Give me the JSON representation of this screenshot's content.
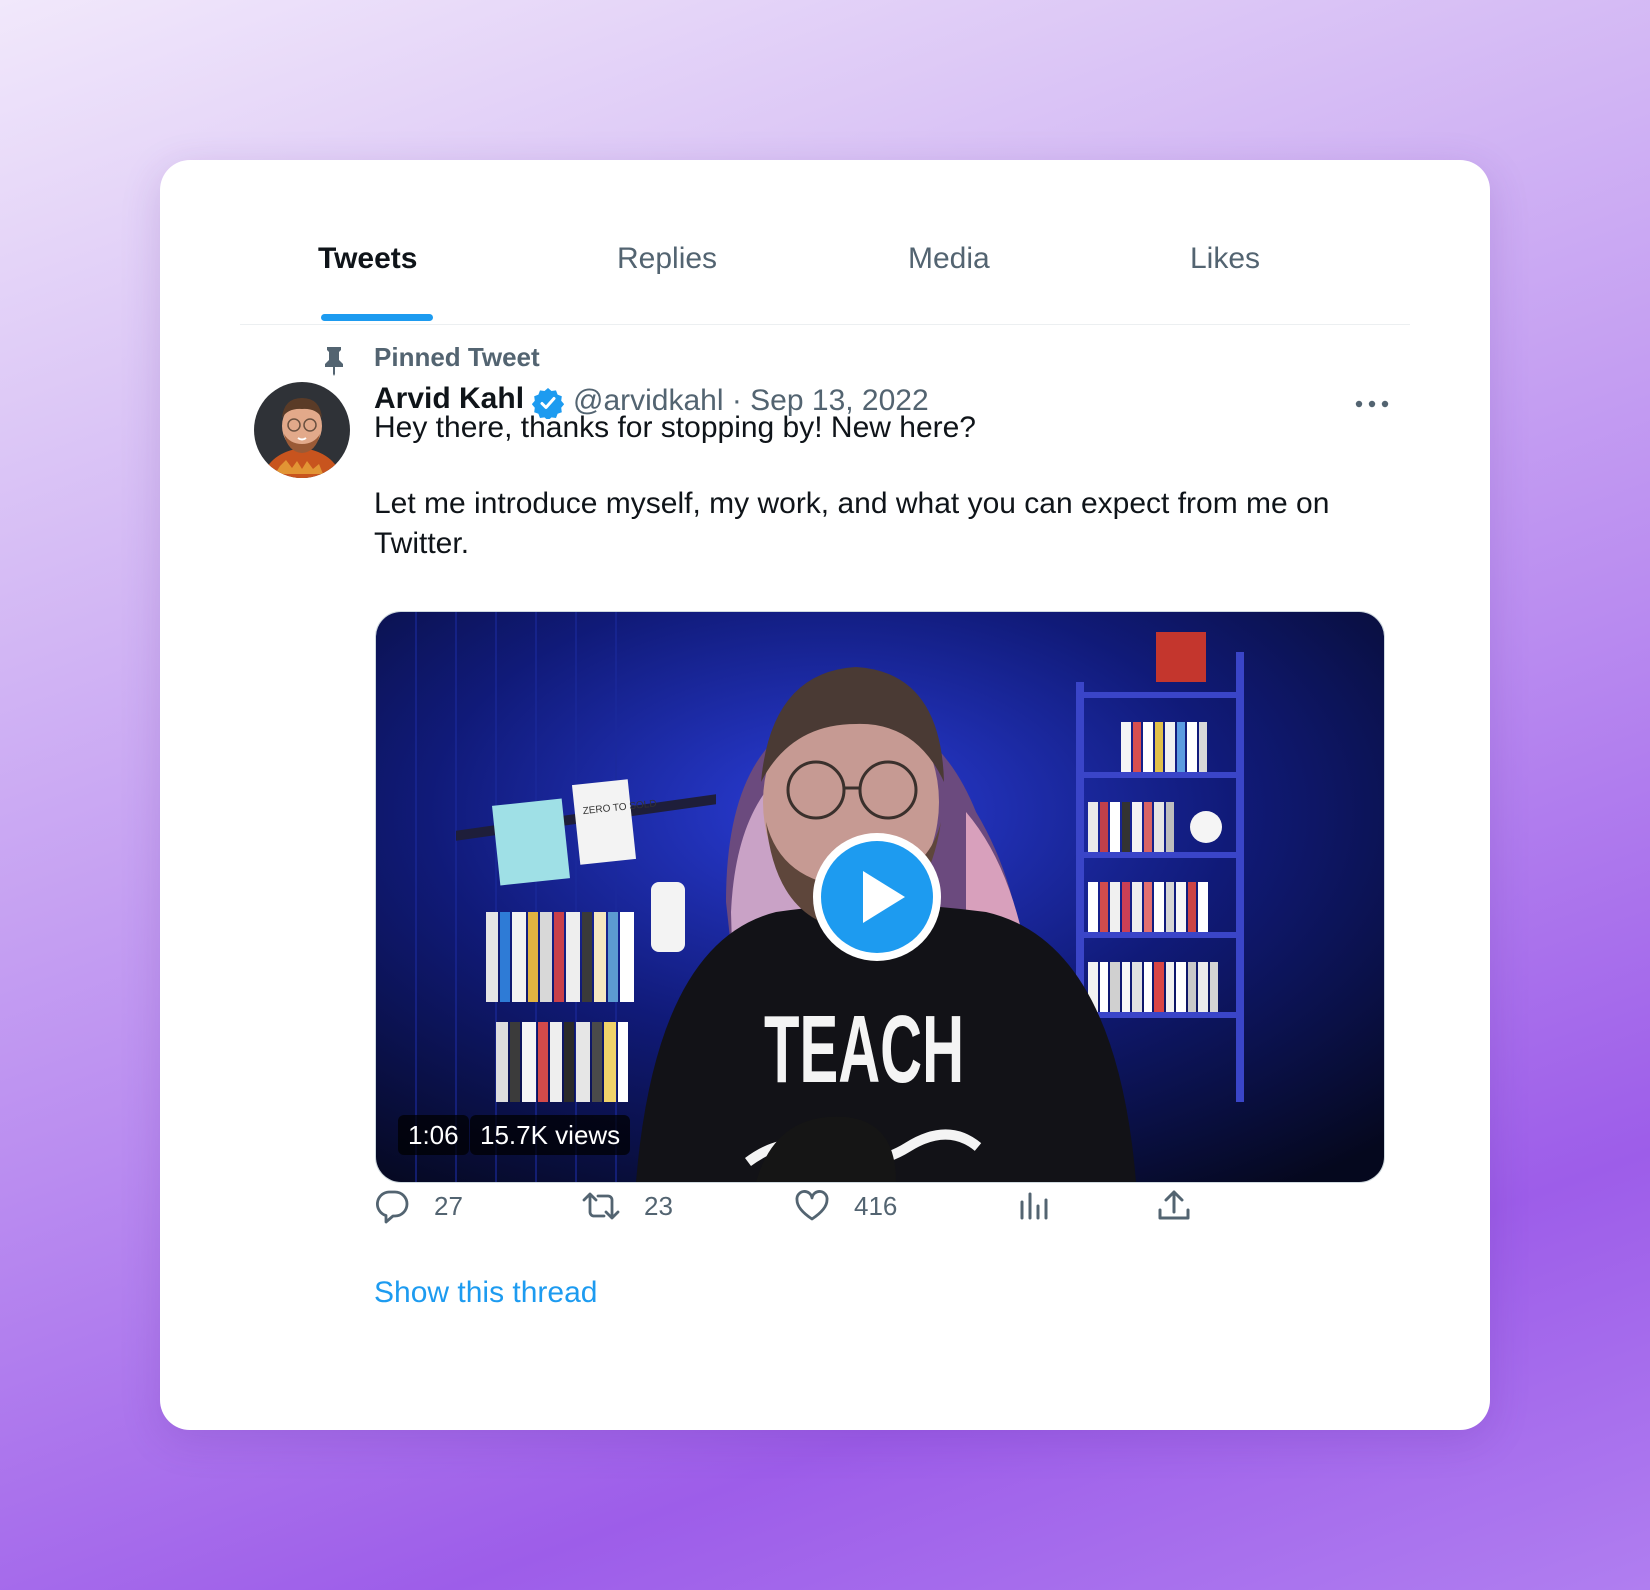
{
  "tabs": [
    {
      "label": "Tweets",
      "active": true
    },
    {
      "label": "Replies",
      "active": false
    },
    {
      "label": "Media",
      "active": false
    },
    {
      "label": "Likes",
      "active": false
    }
  ],
  "tweet": {
    "pinned_label": "Pinned Tweet",
    "author_name": "Arvid Kahl",
    "verified": true,
    "handle_date": "@arvidkahl · Sep 13, 2022",
    "text_line1": "Hey there, thanks for stopping by! New here?",
    "text_line2": "Let me introduce myself, my work, and what you can expect from me on Twitter.",
    "video": {
      "duration": "1:06",
      "views": "15.7K views",
      "shirt_text": "TEACH",
      "book_text": "ZERO TO SOLD"
    },
    "actions": {
      "replies": "27",
      "retweets": "23",
      "likes": "416"
    },
    "show_thread_label": "Show this thread"
  },
  "colors": {
    "accent": "#1d9bf0",
    "text_primary": "#0f1419",
    "text_secondary": "#536471"
  },
  "icons": [
    "pin-icon",
    "verified-badge-icon",
    "more-icon",
    "play-icon",
    "reply-icon",
    "retweet-icon",
    "like-icon",
    "analytics-icon",
    "share-icon"
  ]
}
